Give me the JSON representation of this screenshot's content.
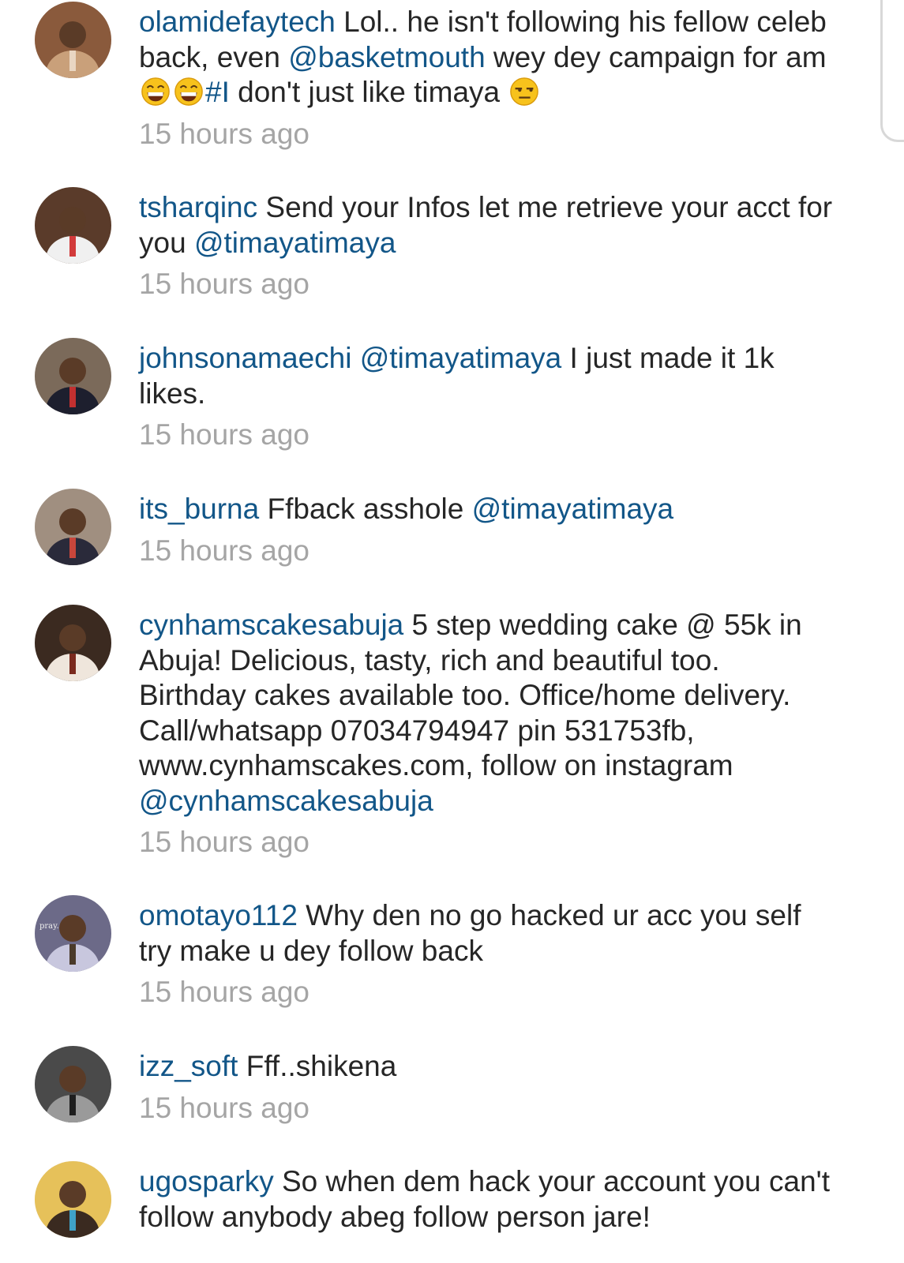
{
  "comments": [
    {
      "username": "olamidefaytech",
      "parts": [
        {
          "t": "text",
          "v": " Lol.. he isn't following his fellow celeb back, even "
        },
        {
          "t": "mention",
          "v": "@basketmouth"
        },
        {
          "t": "text",
          "v": " wey dey campaign for am "
        },
        {
          "t": "emoji",
          "v": "grin-emoji"
        },
        {
          "t": "emoji",
          "v": "grin-emoji"
        },
        {
          "t": "mention",
          "v": "#I"
        },
        {
          "t": "text",
          "v": " don't just like timaya "
        },
        {
          "t": "emoji",
          "v": "unamused-emoji"
        }
      ],
      "time": "15 hours ago",
      "avatar": {
        "icon": "avatar-photo",
        "colors": [
          "#8a5a3c",
          "#c9a07a",
          "#e9d6c2"
        ]
      }
    },
    {
      "username": "tsharqinc",
      "parts": [
        {
          "t": "text",
          "v": " Send your Infos let me retrieve your acct for you "
        },
        {
          "t": "mention",
          "v": "@timayatimaya"
        }
      ],
      "time": "15 hours ago",
      "avatar": {
        "icon": "avatar-photo",
        "colors": [
          "#5a3b2a",
          "#f0f0f0",
          "#d23b3b"
        ]
      }
    },
    {
      "username": "johnsonamaechi",
      "parts": [
        {
          "t": "text",
          "v": " "
        },
        {
          "t": "mention",
          "v": "@timayatimaya"
        },
        {
          "t": "text",
          "v": " I just made it 1k likes."
        }
      ],
      "time": "15 hours ago",
      "avatar": {
        "icon": "avatar-photo",
        "colors": [
          "#7b6a5a",
          "#1d1f2e",
          "#c23030"
        ]
      }
    },
    {
      "username": "its_burna",
      "parts": [
        {
          "t": "text",
          "v": " Ffback asshole "
        },
        {
          "t": "mention",
          "v": "@timayatimaya"
        }
      ],
      "time": "15 hours ago",
      "avatar": {
        "icon": "avatar-photo",
        "colors": [
          "#a08f80",
          "#2a2a3a",
          "#c9463b"
        ]
      }
    },
    {
      "username": "cynhamscakesabuja",
      "parts": [
        {
          "t": "text",
          "v": " 5 step wedding cake @ 55k in Abuja! Delicious,  tasty,  rich and beautiful  too. Birthday cakes available too.  Office/home delivery. Call/whatsapp 07034794947 pin 531753fb, www.cynhamscakes.com, follow on instagram "
        },
        {
          "t": "mention",
          "v": "@cynhamscakesabuja"
        }
      ],
      "time": "15 hours ago",
      "avatar": {
        "icon": "avatar-photo",
        "colors": [
          "#3b2a20",
          "#efe6dc",
          "#7a2a1e"
        ]
      }
    },
    {
      "username": "omotayo112",
      "parts": [
        {
          "t": "text",
          "v": " Why den no go hacked ur acc you self try make u dey follow back"
        }
      ],
      "time": "15 hours ago",
      "avatar": {
        "icon": "avatar-photo",
        "colors": [
          "#6c6a88",
          "#c8c7de",
          "#4a3a2a"
        ],
        "text": "pray."
      }
    },
    {
      "username": "izz_soft",
      "parts": [
        {
          "t": "text",
          "v": " Fff..shikena"
        }
      ],
      "time": "15 hours ago",
      "avatar": {
        "icon": "avatar-photo",
        "colors": [
          "#4a4a4a",
          "#9a9a9a",
          "#1e1e1e"
        ]
      }
    },
    {
      "username": "ugosparky",
      "parts": [
        {
          "t": "text",
          "v": " So when dem hack your account you can't follow anybody abeg follow person jare!"
        }
      ],
      "time": "",
      "avatar": {
        "icon": "avatar-photo",
        "colors": [
          "#e6c15a",
          "#3a2a20",
          "#3fa2c8"
        ]
      }
    }
  ],
  "colors": {
    "username": "#125688",
    "mention": "#125688",
    "text": "#262626",
    "time": "#a5a5a5"
  }
}
